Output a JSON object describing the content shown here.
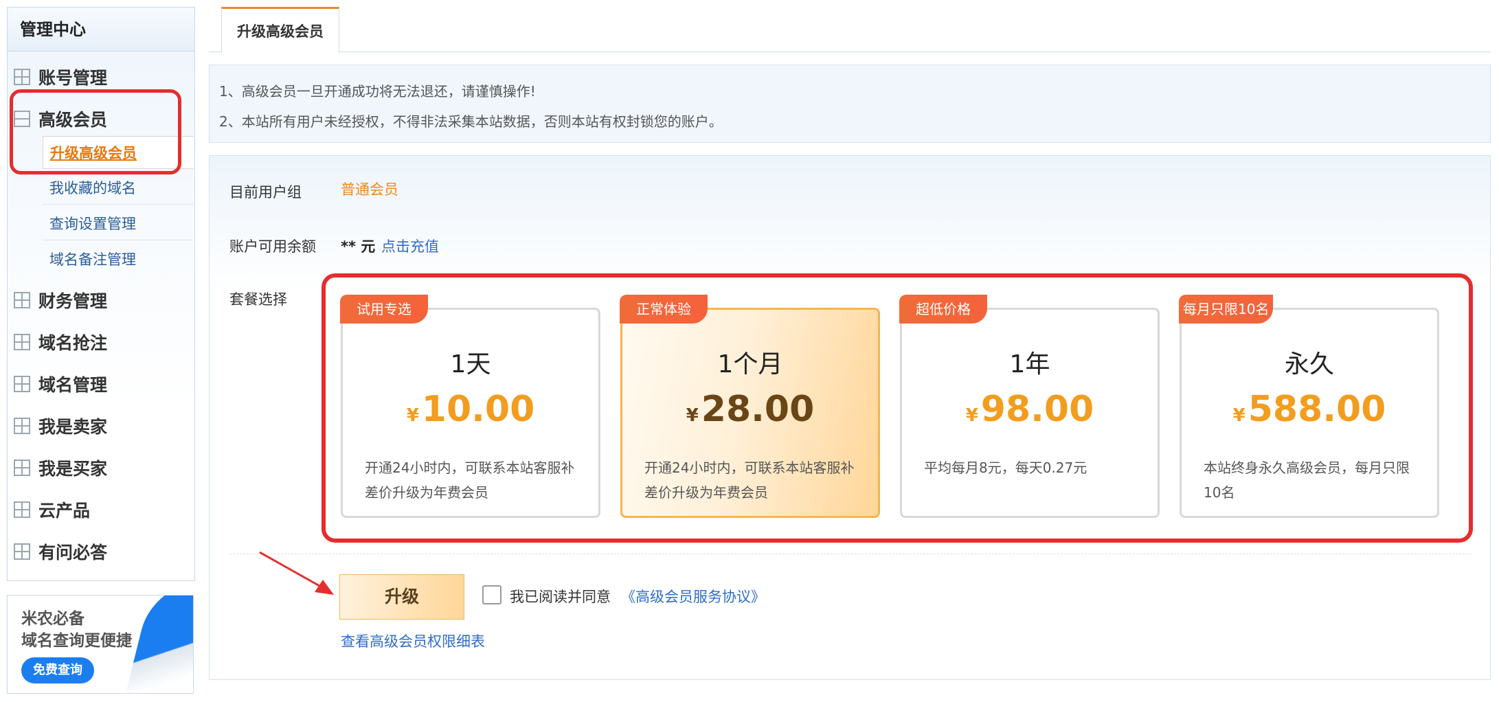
{
  "sidebar": {
    "title": "管理中心",
    "groups": [
      {
        "label": "账号管理"
      },
      {
        "label": "高级会员"
      },
      {
        "label": "财务管理"
      },
      {
        "label": "域名抢注"
      },
      {
        "label": "域名管理"
      },
      {
        "label": "我是卖家"
      },
      {
        "label": "我是买家"
      },
      {
        "label": "云产品"
      },
      {
        "label": "有问必答"
      }
    ],
    "sub_items": [
      {
        "label": "升级高级会员"
      },
      {
        "label": "我收藏的域名"
      },
      {
        "label": "查询设置管理"
      },
      {
        "label": "域名备注管理"
      }
    ]
  },
  "ad": {
    "line1": "米农必备",
    "line2": "域名查询更便捷",
    "button": "免费查询"
  },
  "tab": {
    "label": "升级高级会员"
  },
  "notice": {
    "line1": "1、高级会员一旦开通成功将无法退还，请谨慎操作!",
    "line2": "2、本站所有用户未经授权，不得非法采集本站数据，否则本站有权封锁您的账户。"
  },
  "form": {
    "group_label": "目前用户组",
    "group_value": "普通会员",
    "balance_label": "账户可用余额",
    "balance_value": "** 元",
    "recharge_link": "点击充值",
    "package_label": "套餐选择"
  },
  "packages": [
    {
      "tag": "试用专选",
      "duration": "1天",
      "currency": "¥",
      "price": "10.00",
      "desc": "开通24小时内，可联系本站客服补差价升级为年费会员",
      "selected": false
    },
    {
      "tag": "正常体验",
      "duration": "1个月",
      "currency": "¥",
      "price": "28.00",
      "desc": "开通24小时内，可联系本站客服补差价升级为年费会员",
      "selected": true
    },
    {
      "tag": "超低价格",
      "duration": "1年",
      "currency": "¥",
      "price": "98.00",
      "desc": "平均每月8元，每天0.27元",
      "selected": false
    },
    {
      "tag": "每月只限10名",
      "duration": "永久",
      "currency": "¥",
      "price": "588.00",
      "desc": "本站终身永久高级会员，每月只限10名",
      "selected": false
    }
  ],
  "actions": {
    "upgrade_button": "升级",
    "agree_text": "我已阅读并同意",
    "agree_link": "《高级会员服务协议》",
    "rights_link": "查看高级会员权限细表"
  },
  "colors": {
    "accent_orange": "#f29d1f",
    "link_blue": "#2f6cc7",
    "highlight_red": "#e52d2d",
    "tag_red": "#f06b3a"
  }
}
